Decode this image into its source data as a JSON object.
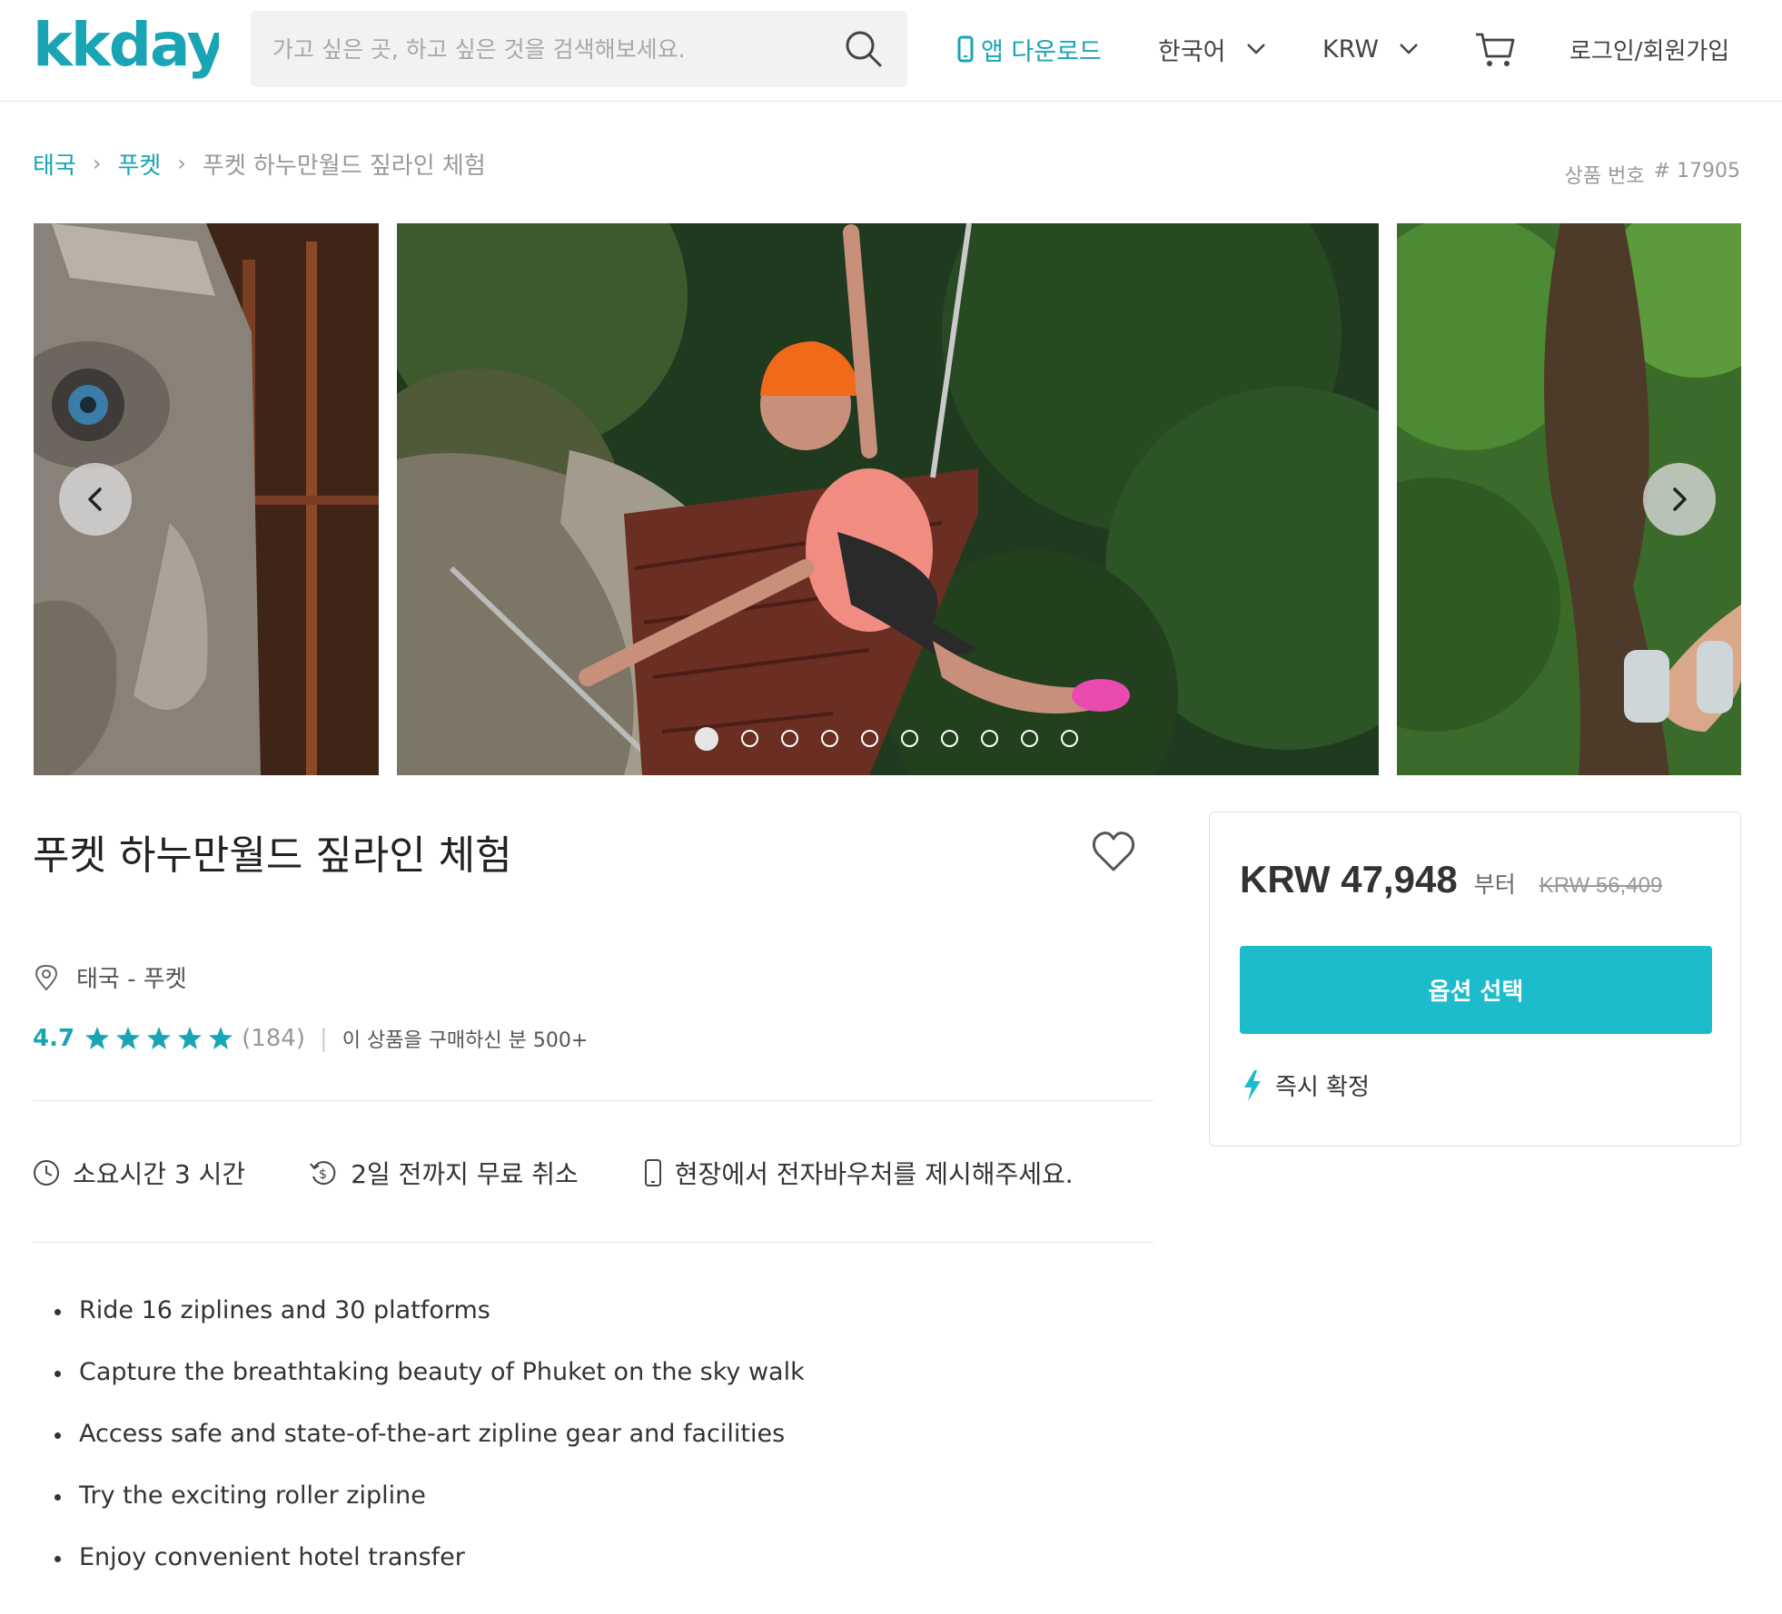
{
  "header": {
    "logo_text": "kkday",
    "search_placeholder": "가고 싶은 곳, 하고 싶은 것을 검색해보세요.",
    "app_download": "앱 다운로드",
    "language": "한국어",
    "currency": "KRW",
    "login": "로그인/회원가입",
    "accent_color": "#1aa5b4"
  },
  "breadcrumb": {
    "items": [
      "태국",
      "푸켓"
    ],
    "current": "푸켓 하누만월드 짚라인 체험"
  },
  "product_no": {
    "label": "상품 번호",
    "value": "# 17905"
  },
  "gallery": {
    "slide_count": 10,
    "active_slide": 1
  },
  "product": {
    "title": "푸켓 하누만월드 짚라인 체험",
    "location": "태국 - 푸켓",
    "rating": "4.7",
    "star_count": 5,
    "reviews": "(184)",
    "purchases": "이 상품을 구매하신 분 500+",
    "features": {
      "duration": "소요시간 3 시간",
      "cancel": "2일 전까지 무료 취소",
      "voucher": "현장에서 전자바우처를 제시해주세요."
    },
    "highlights": [
      "Ride 16 ziplines and 30 platforms",
      "Capture the breathtaking beauty of Phuket on the sky walk",
      "Access safe and state-of-the-art zipline gear and facilities",
      "Try the exciting roller zipline",
      "Enjoy convenient hotel transfer"
    ]
  },
  "price_card": {
    "price": "KRW 47,948",
    "from_label": "부터",
    "original_price": "KRW 56,409",
    "select_button": "옵션 선택",
    "instant_confirm": "즉시 확정",
    "button_color": "#1dbccc"
  }
}
